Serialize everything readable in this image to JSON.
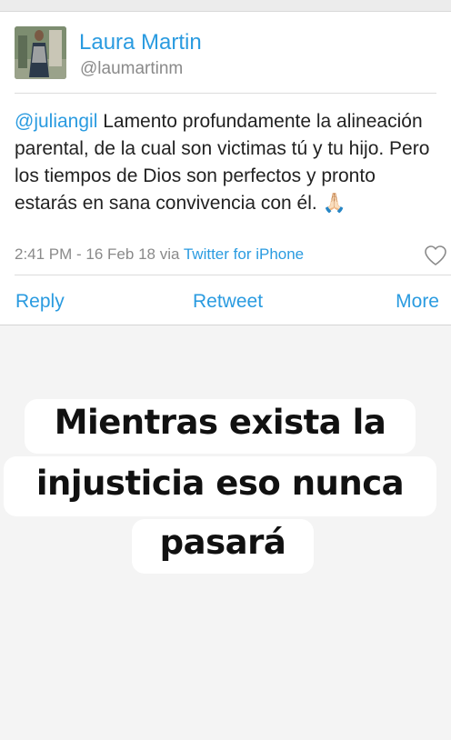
{
  "tweet": {
    "author_name": "Laura Martin",
    "author_handle": "@laumartinm",
    "mention": "@juliangil",
    "body": " Lamento profundamente la alineación parental, de la cual son victimas tú y tu hijo. Pero los tiempos de Dios son perfectos y pronto estarás en sana convivencia con él. 🙏🏻",
    "timestamp": "2:41 PM - 16 Feb 18 via ",
    "via": "Twitter for iPhone",
    "like_icon": "heart-icon"
  },
  "actions": {
    "reply": "Reply",
    "retweet": "Retweet",
    "more": "More"
  },
  "caption": {
    "line1": "Mientras exista la",
    "line2": "injusticia eso nunca",
    "line3": "pasará"
  },
  "colors": {
    "accent": "#2a9be0",
    "background": "#f4f4f4"
  }
}
